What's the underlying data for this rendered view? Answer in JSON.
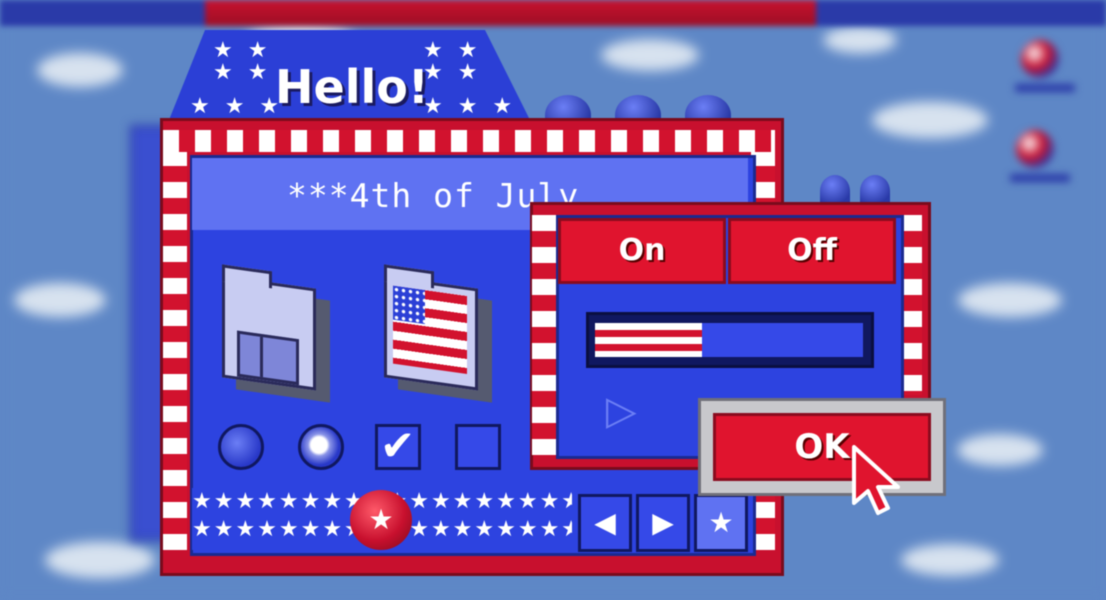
{
  "window": {
    "title": "Hello!",
    "panel_title": "***4th of July",
    "stars_top": "★ ★\n★ ★",
    "stars_row": "★ ★ ★"
  },
  "controls": {
    "star_strip_row": "★★★★★★★★★★★★★★★★★★",
    "star_button_glyph": "★",
    "nav_prev_glyph": "◀",
    "nav_next_glyph": "▶",
    "nav_star_glyph": "★"
  },
  "dialog": {
    "on_label": "On",
    "off_label": "Off",
    "progress_fraction": 0.4,
    "play_glyph": "▷",
    "ok_label": "OK"
  },
  "icons": [
    "finder-folder-icon",
    "flag-folder-icon"
  ],
  "colors": {
    "red": "#c8102e",
    "blue": "#2d43e0",
    "white": "#ffffff"
  }
}
